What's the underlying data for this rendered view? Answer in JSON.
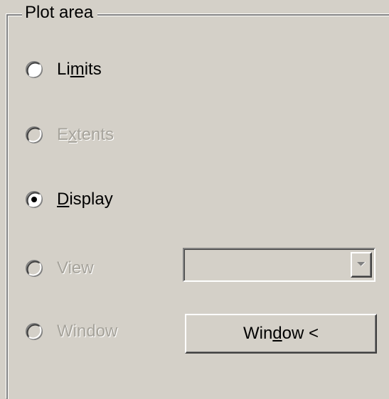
{
  "group": {
    "title": "Plot area"
  },
  "options": {
    "limits": {
      "label_pre": "Li",
      "label_key": "m",
      "label_post": "its",
      "selected": false,
      "enabled": true
    },
    "extents": {
      "label_pre": "E",
      "label_key": "x",
      "label_post": "tents",
      "selected": false,
      "enabled": false
    },
    "display": {
      "label_pre": "",
      "label_key": "D",
      "label_post": "isplay",
      "selected": true,
      "enabled": true
    },
    "view": {
      "label": "View",
      "selected": false,
      "enabled": false
    },
    "window": {
      "label": "Window",
      "selected": false,
      "enabled": false
    }
  },
  "view_select": {
    "value": "",
    "enabled": false,
    "arrow_icon": "chevron-down-icon"
  },
  "window_button": {
    "label_pre": "Win",
    "label_key": "d",
    "label_post": "ow <"
  },
  "colors": {
    "dialog_background": "#d4d0c8",
    "shadow": "#808080",
    "highlight": "#ffffff",
    "disabled_text": "#a6a39b"
  }
}
